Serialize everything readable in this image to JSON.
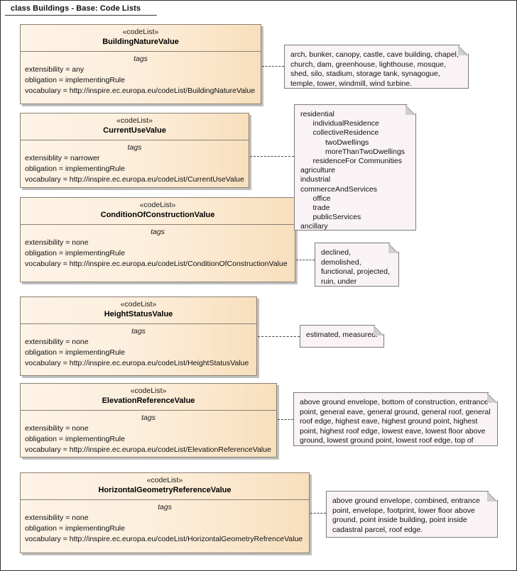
{
  "diagram": {
    "title": "class Buildings - Base: Code Lists"
  },
  "classes": [
    {
      "stereotype": "«codeList»",
      "name": "BuildingNatureValue",
      "compartment_title": "tags",
      "tags": [
        "extensibility = any",
        "obligation = implementingRule",
        "vocabulary = http://inspire.ec.europa.eu/codeList/BuildingNatureValue"
      ]
    },
    {
      "stereotype": "«codeList»",
      "name": "CurrentUseValue",
      "compartment_title": "tags",
      "tags": [
        "extensiblity = narrower",
        "obligation = implementingRule",
        "vocabulary = http://inspire.ec.europa.eu/codeList/CurrentUseValue"
      ]
    },
    {
      "stereotype": "«codeList»",
      "name": "ConditionOfConstructionValue",
      "compartment_title": "tags",
      "tags": [
        "extensibility = none",
        "obligation = implementingRule",
        "vocabulary = http://inspire.ec.europa.eu/codeList/ConditionOfConstructionValue"
      ]
    },
    {
      "stereotype": "«codeList»",
      "name": "HeightStatusValue",
      "compartment_title": "tags",
      "tags": [
        "extensibility = none",
        "obligation = implementingRule",
        "vocabulary = http://inspire.ec.europa.eu/codeList/HeightStatusValue"
      ]
    },
    {
      "stereotype": "«codeList»",
      "name": "ElevationReferenceValue",
      "compartment_title": "tags",
      "tags": [
        "extensibility = none",
        "obligation = implementingRule",
        "vocabulary = http://inspire.ec.europa.eu/codeList/ElevationReferenceValue"
      ]
    },
    {
      "stereotype": "«codeList»",
      "name": "HorizontalGeometryReferenceValue",
      "compartment_title": "tags",
      "tags": [
        "extensibility = none",
        "obligation = implementingRule",
        "vocabulary = http://inspire.ec.europa.eu/codeList/HorizontalGeometryRefrenceValue"
      ]
    }
  ],
  "notes": [
    {
      "id": "note-building-nature",
      "text": "arch, bunker, canopy, castle, cave building, chapel, church, dam, greenhouse, lighthouse, mosque, shed, silo, stadium, storage tank, synagogue, temple, tower, windmill, wind turbine."
    },
    {
      "id": "note-current-use",
      "lines": [
        "residential",
        "      individualResidence",
        "      collectiveResidence",
        "            twoDwellings",
        "            moreThanTwoDwellings",
        "      residenceFor Communities",
        "agriculture",
        "industrial",
        "commerceAndServices",
        "      office",
        "      trade",
        "      publicServices",
        "ancillary"
      ]
    },
    {
      "id": "note-condition-of-construction",
      "text": "declined, demolished, functional, projected, ruin, under construction."
    },
    {
      "id": "note-height-status",
      "text": "estimated, measured."
    },
    {
      "id": "note-elevation-reference",
      "text": "above ground envelope, bottom of construction, entrance point, general eave, general ground, general roof, general roof edge, highest eave, highest ground point, highest point, highest roof edge, lowest eave, lowest floor above ground, lowest ground point, lowest roof edge, top of construction."
    },
    {
      "id": "note-horizontal-geometry-reference",
      "text": "above ground envelope, combined, entrance point, envelope, footprint, lower floor above ground, point inside building, point inside cadastral parcel, roof edge."
    }
  ],
  "colors": {
    "class_fill_light": "#fdf3e6",
    "class_fill_dark": "#f7dfbd",
    "class_border": "#8a8071",
    "note_fill": "#f9f3f5",
    "note_border": "#7b7b7b",
    "canvas_border": "#333333"
  }
}
